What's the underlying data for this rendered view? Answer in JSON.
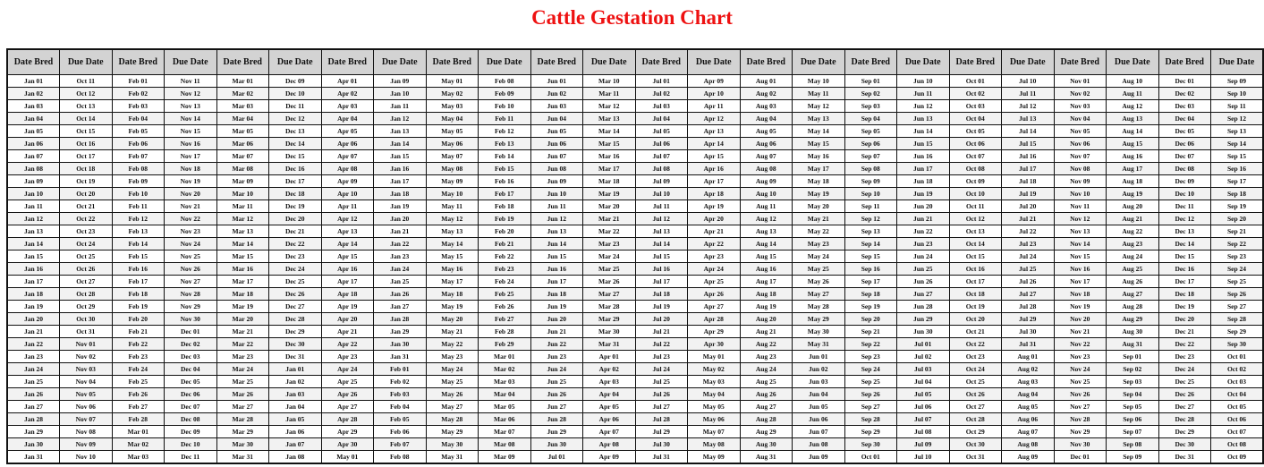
{
  "title": "Cattle Gestation Chart",
  "header_labels": [
    "Date Bred",
    "Due Date",
    "Date Bred",
    "Due Date",
    "Date Bred",
    "Due Date",
    "Date Bred",
    "Due Date",
    "Date Bred",
    "Due Date",
    "Date Bred",
    "Due Date",
    "Date Bred",
    "Due Date",
    "Date Bred",
    "Due Date",
    "Date Bred",
    "Due Date",
    "Date Bred",
    "Due Date",
    "Date Bred",
    "Due Date",
    "Date Bred",
    "Due Date"
  ],
  "colors": {
    "title": "#ee1111",
    "header_bg": "#d3d3d3",
    "alt_row_bg": "#f2f2f2",
    "border": "#111111"
  },
  "groups": [
    {
      "bred": [
        "Jan 01",
        "Jan 02",
        "Jan 03",
        "Jan 04",
        "Jan 05",
        "Jan 06",
        "Jan 07",
        "Jan 08",
        "Jan 09",
        "Jan 10",
        "Jan 11",
        "Jan 12",
        "Jan 13",
        "Jan 14",
        "Jan 15",
        "Jan 16",
        "Jan 17",
        "Jan 18",
        "Jan 19",
        "Jan 20",
        "Jan 21",
        "Jan 22",
        "Jan 23",
        "Jan 24",
        "Jan 25",
        "Jan 26",
        "Jan 27",
        "Jan 28",
        "Jan 29",
        "Jan 30",
        "Jan 31"
      ],
      "due": [
        "Oct 11",
        "Oct 12",
        "Oct 13",
        "Oct 14",
        "Oct 15",
        "Oct 16",
        "Oct 17",
        "Oct 18",
        "Oct 19",
        "Oct 20",
        "Oct 21",
        "Oct 22",
        "Oct 23",
        "Oct 24",
        "Oct 25",
        "Oct 26",
        "Oct 27",
        "Oct 28",
        "Oct 29",
        "Oct 30",
        "Oct 31",
        "Nov 01",
        "Nov 02",
        "Nov 03",
        "Nov 04",
        "Nov 05",
        "Nov 06",
        "Nov 07",
        "Nov 08",
        "Nov 09",
        "Nov 10"
      ]
    },
    {
      "bred": [
        "Feb 01",
        "Feb 02",
        "Feb 03",
        "Feb 04",
        "Feb 05",
        "Feb 06",
        "Feb 07",
        "Feb 08",
        "Feb 09",
        "Feb 10",
        "Feb 11",
        "Feb 12",
        "Feb 13",
        "Feb 14",
        "Feb 15",
        "Feb 16",
        "Feb 17",
        "Feb 18",
        "Feb 19",
        "Feb 20",
        "Feb 21",
        "Feb 22",
        "Feb 23",
        "Feb 24",
        "Feb 25",
        "Feb 26",
        "Feb 27",
        "Feb 28",
        "Mar 01",
        "Mar 02",
        "Mar 03"
      ],
      "due": [
        "Nov 11",
        "Nov 12",
        "Nov 13",
        "Nov 14",
        "Nov 15",
        "Nov 16",
        "Nov 17",
        "Nov 18",
        "Nov 19",
        "Nov 20",
        "Nov 21",
        "Nov 22",
        "Nov 23",
        "Nov 24",
        "Nov 25",
        "Nov 26",
        "Nov 27",
        "Nov 28",
        "Nov 29",
        "Nov 30",
        "Dec 01",
        "Dec 02",
        "Dec 03",
        "Dec 04",
        "Dec 05",
        "Dec 06",
        "Dec 07",
        "Dec 08",
        "Dec 09",
        "Dec 10",
        "Dec 11"
      ]
    },
    {
      "bred": [
        "Mar 01",
        "Mar 02",
        "Mar 03",
        "Mar 04",
        "Mar 05",
        "Mar 06",
        "Mar 07",
        "Mar 08",
        "Mar 09",
        "Mar 10",
        "Mar 11",
        "Mar 12",
        "Mar 13",
        "Mar 14",
        "Mar 15",
        "Mar 16",
        "Mar 17",
        "Mar 18",
        "Mar 19",
        "Mar 20",
        "Mar 21",
        "Mar 22",
        "Mar 23",
        "Mar 24",
        "Mar 25",
        "Mar 26",
        "Mar 27",
        "Mar 28",
        "Mar 29",
        "Mar 30",
        "Mar 31"
      ],
      "due": [
        "Dec 09",
        "Dec 10",
        "Dec 11",
        "Dec 12",
        "Dec 13",
        "Dec 14",
        "Dec 15",
        "Dec 16",
        "Dec 17",
        "Dec 18",
        "Dec 19",
        "Dec 20",
        "Dec 21",
        "Dec 22",
        "Dec 23",
        "Dec 24",
        "Dec 25",
        "Dec 26",
        "Dec 27",
        "Dec 28",
        "Dec 29",
        "Dec 30",
        "Dec 31",
        "Jan 01",
        "Jan 02",
        "Jan 03",
        "Jan 04",
        "Jan 05",
        "Jan 06",
        "Jan 07",
        "Jan 08"
      ]
    },
    {
      "bred": [
        "Apr 01",
        "Apr 02",
        "Apr 03",
        "Apr 04",
        "Apr 05",
        "Apr 06",
        "Apr 07",
        "Apr 08",
        "Apr 09",
        "Apr 10",
        "Apr 11",
        "Apr 12",
        "Apr 13",
        "Apr 14",
        "Apr 15",
        "Apr 16",
        "Apr 17",
        "Apr 18",
        "Apr 19",
        "Apr 20",
        "Apr 21",
        "Apr 22",
        "Apr 23",
        "Apr 24",
        "Apr 25",
        "Apr 26",
        "Apr 27",
        "Apr 28",
        "Apr 29",
        "Apr 30",
        "May 01"
      ],
      "due": [
        "Jan 09",
        "Jan 10",
        "Jan 11",
        "Jan 12",
        "Jan 13",
        "Jan 14",
        "Jan 15",
        "Jan 16",
        "Jan 17",
        "Jan 18",
        "Jan 19",
        "Jan 20",
        "Jan 21",
        "Jan 22",
        "Jan 23",
        "Jan 24",
        "Jan 25",
        "Jan 26",
        "Jan 27",
        "Jan 28",
        "Jan 29",
        "Jan 30",
        "Jan 31",
        "Feb 01",
        "Feb 02",
        "Feb 03",
        "Feb 04",
        "Feb 05",
        "Feb 06",
        "Feb 07",
        "Feb 08"
      ]
    },
    {
      "bred": [
        "May 01",
        "May 02",
        "May 03",
        "May 04",
        "May 05",
        "May 06",
        "May 07",
        "May 08",
        "May 09",
        "May 10",
        "May 11",
        "May 12",
        "May 13",
        "May 14",
        "May 15",
        "May 16",
        "May 17",
        "May 18",
        "May 19",
        "May 20",
        "May 21",
        "May 22",
        "May 23",
        "May 24",
        "May 25",
        "May 26",
        "May 27",
        "May 28",
        "May 29",
        "May 30",
        "May 31"
      ],
      "due": [
        "Feb 08",
        "Feb 09",
        "Feb 10",
        "Feb 11",
        "Feb 12",
        "Feb 13",
        "Feb 14",
        "Feb 15",
        "Feb 16",
        "Feb 17",
        "Feb 18",
        "Feb 19",
        "Feb 20",
        "Feb 21",
        "Feb 22",
        "Feb 23",
        "Feb 24",
        "Feb 25",
        "Feb 26",
        "Feb 27",
        "Feb 28",
        "Feb 29",
        "Mar 01",
        "Mar 02",
        "Mar 03",
        "Mar 04",
        "Mar 05",
        "Mar 06",
        "Mar 07",
        "Mar 08",
        "Mar 09"
      ]
    },
    {
      "bred": [
        "Jun 01",
        "Jun 02",
        "Jun 03",
        "Jun 04",
        "Jun 05",
        "Jun 06",
        "Jun 07",
        "Jun 08",
        "Jun 09",
        "Jun 10",
        "Jun 11",
        "Jun 12",
        "Jun 13",
        "Jun 14",
        "Jun 15",
        "Jun 16",
        "Jun 17",
        "Jun 18",
        "Jun 19",
        "Jun 20",
        "Jun 21",
        "Jun 22",
        "Jun 23",
        "Jun 24",
        "Jun 25",
        "Jun 26",
        "Jun 27",
        "Jun 28",
        "Jun 29",
        "Jun 30",
        "Jul 01"
      ],
      "due": [
        "Mar 10",
        "Mar 11",
        "Mar 12",
        "Mar 13",
        "Mar 14",
        "Mar 15",
        "Mar 16",
        "Mar 17",
        "Mar 18",
        "Mar 19",
        "Mar 20",
        "Mar 21",
        "Mar 22",
        "Mar 23",
        "Mar 24",
        "Mar 25",
        "Mar 26",
        "Mar 27",
        "Mar 28",
        "Mar 29",
        "Mar 30",
        "Mar 31",
        "Apr 01",
        "Apr 02",
        "Apr 03",
        "Apr 04",
        "Apr 05",
        "Apr 06",
        "Apr 07",
        "Apr 08",
        "Apr 09"
      ]
    },
    {
      "bred": [
        "Jul 01",
        "Jul 02",
        "Jul 03",
        "Jul 04",
        "Jul 05",
        "Jul 06",
        "Jul 07",
        "Jul 08",
        "Jul 09",
        "Jul 10",
        "Jul 11",
        "Jul 12",
        "Jul 13",
        "Jul 14",
        "Jul 15",
        "Jul 16",
        "Jul 17",
        "Jul 18",
        "Jul 19",
        "Jul 20",
        "Jul 21",
        "Jul 22",
        "Jul 23",
        "Jul 24",
        "Jul 25",
        "Jul 26",
        "Jul 27",
        "Jul 28",
        "Jul 29",
        "Jul 30",
        "Jul 31"
      ],
      "due": [
        "Apr 09",
        "Apr 10",
        "Apr 11",
        "Apr 12",
        "Apr 13",
        "Apr 14",
        "Apr 15",
        "Apr 16",
        "Apr 17",
        "Apr 18",
        "Apr 19",
        "Apr 20",
        "Apr 21",
        "Apr 22",
        "Apr 23",
        "Apr 24",
        "Apr 25",
        "Apr 26",
        "Apr 27",
        "Apr 28",
        "Apr 29",
        "Apr 30",
        "May 01",
        "May 02",
        "May 03",
        "May 04",
        "May 05",
        "May 06",
        "May 07",
        "May 08",
        "May 09"
      ]
    },
    {
      "bred": [
        "Aug 01",
        "Aug 02",
        "Aug 03",
        "Aug 04",
        "Aug 05",
        "Aug 06",
        "Aug 07",
        "Aug 08",
        "Aug 09",
        "Aug 10",
        "Aug 11",
        "Aug 12",
        "Aug 13",
        "Aug 14",
        "Aug 15",
        "Aug 16",
        "Aug 17",
        "Aug 18",
        "Aug 19",
        "Aug 20",
        "Aug 21",
        "Aug 22",
        "Aug 23",
        "Aug 24",
        "Aug 25",
        "Aug 26",
        "Aug 27",
        "Aug 28",
        "Aug 29",
        "Aug 30",
        "Aug 31"
      ],
      "due": [
        "May 10",
        "May 11",
        "May 12",
        "May 13",
        "May 14",
        "May 15",
        "May 16",
        "May 17",
        "May 18",
        "May 19",
        "May 20",
        "May 21",
        "May 22",
        "May 23",
        "May 24",
        "May 25",
        "May 26",
        "May 27",
        "May 28",
        "May 29",
        "May 30",
        "May 31",
        "Jun 01",
        "Jun 02",
        "Jun 03",
        "Jun 04",
        "Jun 05",
        "Jun 06",
        "Jun 07",
        "Jun 08",
        "Jun 09"
      ]
    },
    {
      "bred": [
        "Sep 01",
        "Sep 02",
        "Sep 03",
        "Sep 04",
        "Sep 05",
        "Sep 06",
        "Sep 07",
        "Sep 08",
        "Sep 09",
        "Sep 10",
        "Sep 11",
        "Sep 12",
        "Sep 13",
        "Sep 14",
        "Sep 15",
        "Sep 16",
        "Sep 17",
        "Sep 18",
        "Sep 19",
        "Sep 20",
        "Sep 21",
        "Sep 22",
        "Sep 23",
        "Sep 24",
        "Sep 25",
        "Sep 26",
        "Sep 27",
        "Sep 28",
        "Sep 29",
        "Sep 30",
        "Oct 01"
      ],
      "due": [
        "Jun 10",
        "Jun 11",
        "Jun 12",
        "Jun 13",
        "Jun 14",
        "Jun 15",
        "Jun 16",
        "Jun 17",
        "Jun 18",
        "Jun 19",
        "Jun 20",
        "Jun 21",
        "Jun 22",
        "Jun 23",
        "Jun 24",
        "Jun 25",
        "Jun 26",
        "Jun 27",
        "Jun 28",
        "Jun 29",
        "Jun 30",
        "Jul 01",
        "Jul 02",
        "Jul 03",
        "Jul 04",
        "Jul 05",
        "Jul 06",
        "Jul 07",
        "Jul 08",
        "Jul 09",
        "Jul 10"
      ]
    },
    {
      "bred": [
        "Oct 01",
        "Oct 02",
        "Oct 03",
        "Oct 04",
        "Oct 05",
        "Oct 06",
        "Oct 07",
        "Oct 08",
        "Oct 09",
        "Oct 10",
        "Oct 11",
        "Oct 12",
        "Oct 13",
        "Oct 14",
        "Oct 15",
        "Oct 16",
        "Oct 17",
        "Oct 18",
        "Oct 19",
        "Oct 20",
        "Oct 21",
        "Oct 22",
        "Oct 23",
        "Oct 24",
        "Oct 25",
        "Oct 26",
        "Oct 27",
        "Oct 28",
        "Oct 29",
        "Oct 30",
        "Oct 31"
      ],
      "due": [
        "Jul 10",
        "Jul 11",
        "Jul 12",
        "Jul 13",
        "Jul 14",
        "Jul 15",
        "Jul 16",
        "Jul 17",
        "Jul 18",
        "Jul 19",
        "Jul 20",
        "Jul 21",
        "Jul 22",
        "Jul 23",
        "Jul 24",
        "Jul 25",
        "Jul 26",
        "Jul 27",
        "Jul 28",
        "Jul 29",
        "Jul 30",
        "Jul 31",
        "Aug 01",
        "Aug 02",
        "Aug 03",
        "Aug 04",
        "Aug 05",
        "Aug 06",
        "Aug 07",
        "Aug 08",
        "Aug 09"
      ]
    },
    {
      "bred": [
        "Nov 01",
        "Nov 02",
        "Nov 03",
        "Nov 04",
        "Nov 05",
        "Nov 06",
        "Nov 07",
        "Nov 08",
        "Nov 09",
        "Nov 10",
        "Nov 11",
        "Nov 12",
        "Nov 13",
        "Nov 14",
        "Nov 15",
        "Nov 16",
        "Nov 17",
        "Nov 18",
        "Nov 19",
        "Nov 20",
        "Nov 21",
        "Nov 22",
        "Nov 23",
        "Nov 24",
        "Nov 25",
        "Nov 26",
        "Nov 27",
        "Nov 28",
        "Nov 29",
        "Nov 30",
        "Dec 01"
      ],
      "due": [
        "Aug 10",
        "Aug 11",
        "Aug 12",
        "Aug 13",
        "Aug 14",
        "Aug 15",
        "Aug 16",
        "Aug 17",
        "Aug 18",
        "Aug 19",
        "Aug 20",
        "Aug 21",
        "Aug 22",
        "Aug 23",
        "Aug 24",
        "Aug 25",
        "Aug 26",
        "Aug 27",
        "Aug 28",
        "Aug 29",
        "Aug 30",
        "Aug 31",
        "Sep 01",
        "Sep 02",
        "Sep 03",
        "Sep 04",
        "Sep 05",
        "Sep 06",
        "Sep 07",
        "Sep 08",
        "Sep 09"
      ]
    },
    {
      "bred": [
        "Dec 01",
        "Dec 02",
        "Dec 03",
        "Dec 04",
        "Dec 05",
        "Dec 06",
        "Dec 07",
        "Dec 08",
        "Dec 09",
        "Dec 10",
        "Dec 11",
        "Dec 12",
        "Dec 13",
        "Dec 14",
        "Dec 15",
        "Dec 16",
        "Dec 17",
        "Dec 18",
        "Dec 19",
        "Dec 20",
        "Dec 21",
        "Dec 22",
        "Dec 23",
        "Dec 24",
        "Dec 25",
        "Dec 26",
        "Dec 27",
        "Dec 28",
        "Dec 29",
        "Dec 30",
        "Dec 31"
      ],
      "due": [
        "Sep 09",
        "Sep 10",
        "Sep 11",
        "Sep 12",
        "Sep 13",
        "Sep 14",
        "Sep 15",
        "Sep 16",
        "Sep 17",
        "Sep 18",
        "Sep 19",
        "Sep 20",
        "Sep 21",
        "Sep 22",
        "Sep 23",
        "Sep 24",
        "Sep 25",
        "Sep 26",
        "Sep 27",
        "Sep 28",
        "Sep 29",
        "Sep 30",
        "Oct 01",
        "Oct 02",
        "Oct 03",
        "Oct 04",
        "Oct 05",
        "Oct 06",
        "Oct 07",
        "Oct 08",
        "Oct 09"
      ]
    }
  ]
}
